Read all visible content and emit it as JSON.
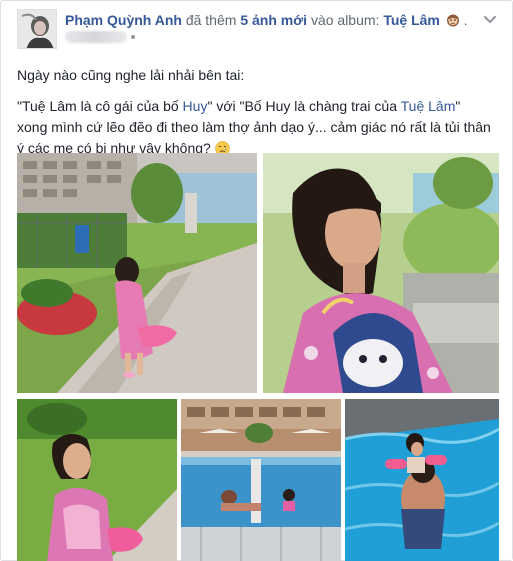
{
  "post": {
    "author": "Phạm Quỳnh Anh",
    "action_prefix": "đã thêm",
    "added_count": "5 ảnh mới",
    "action_suffix": "vào album:",
    "album": "Tuệ Lâm",
    "album_emoji_icon": "monkey-emoji-icon",
    "menu_icon": "chevron-down-icon",
    "privacy_dot": "·"
  },
  "body": {
    "line1": "Ngày nào cũng nghe lải nhải bên tai:",
    "q_open": "\"Tuệ Lâm là cô gái của bố ",
    "tag_huy": "Huy",
    "q_mid": "\" với \"Bố Huy là chàng trai của ",
    "tag_tue_lam": "Tuệ Lâm",
    "q_close": "\"",
    "line3": "xong mình cứ lẽo đẽo đi theo làm thợ ảnh dạo ý... cảm giác nó rất là tủi thân",
    "line4": "ý các mẹ có bị như vậy không?",
    "emoji_icon": "crying-face-emoji-icon"
  },
  "photos": [
    {
      "name": "photo-girl-walking-path",
      "alt": "Girl in pink towel walking on path"
    },
    {
      "name": "photo-girl-closeup-pool",
      "alt": "Girl with towel near pool"
    },
    {
      "name": "photo-girl-grass",
      "alt": "Girl on grass"
    },
    {
      "name": "photo-pool-overview",
      "alt": "Pool with building"
    },
    {
      "name": "photo-swimming-father",
      "alt": "Girl with father in pool"
    }
  ],
  "colors": {
    "link": "#365899",
    "text": "#1d2129",
    "muted": "#616770",
    "border": "#dddfe2"
  }
}
